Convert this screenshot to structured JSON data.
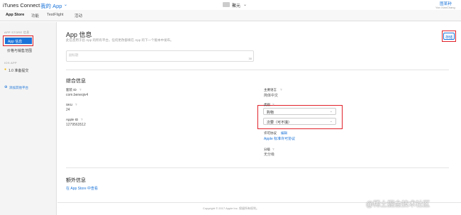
{
  "header": {
    "app_title": "iTunes Connect",
    "app_menu": "我的 App",
    "center_title": "聚元",
    "user_name": "图某利",
    "user_sub": "Yan XianChang"
  },
  "tabs": [
    "App Store",
    "功能",
    "TestFlight",
    "活动"
  ],
  "sidebar": {
    "section1": "APP STORE 信息",
    "items": [
      "App 信息",
      "价格与销售范围"
    ],
    "section2": "IOS APP",
    "version_item": "1.0 准备提交",
    "add_platform": "添加其他平台"
  },
  "main": {
    "title": "App 信息",
    "description": "此信息用于您 App 的所有平台，任何更改都将在 App 的下一个版本中发布。",
    "save_label": "存储",
    "subtitle_placeholder": "副标题",
    "subtitle_count": "30",
    "general_heading": "综合信息",
    "bundle_id_label": "套装 ID",
    "bundle_id_value": "com.beneqiv4",
    "sku_label": "SKU",
    "sku_value": "24",
    "apple_id_label": "Apple ID",
    "apple_id_value": "1279563512",
    "primary_lang_label": "主要语言",
    "primary_lang_value": "简体中文",
    "category_label": "类别",
    "category_primary": "购物",
    "category_secondary": "次要（可不填）",
    "license_label": "许可协议",
    "license_edit": "编辑",
    "license_link": "Apple 标准许可协议",
    "rating_label": "分级",
    "rating_value": "无分级",
    "additional_heading": "额外信息",
    "store_link": "在 App Store 中查看",
    "footer": "Copyright © 2017 Apple Inc. 保留所有权利。"
  },
  "watermark": "@稀土掘金技术社区",
  "colors": {
    "link": "#1a73d9",
    "highlight_box": "#e0222a"
  }
}
